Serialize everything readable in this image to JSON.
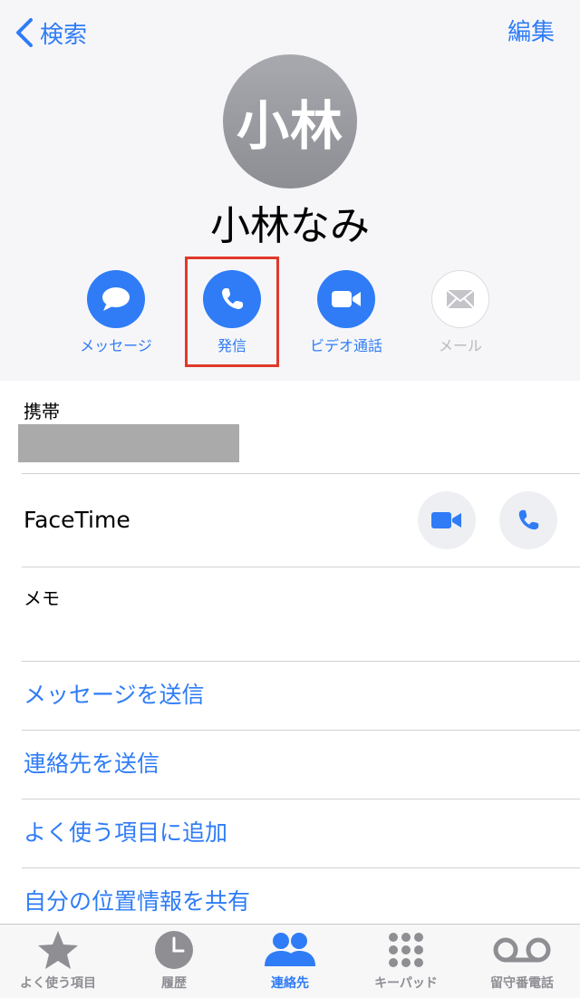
{
  "nav": {
    "back_label": "検索",
    "edit_label": "編集"
  },
  "contact": {
    "avatar_initials": "小林",
    "name": "小林なみ"
  },
  "actions": [
    {
      "label": "メッセージ",
      "icon": "message-bubble-icon",
      "enabled": true
    },
    {
      "label": "発信",
      "icon": "phone-icon",
      "enabled": true,
      "highlighted": true
    },
    {
      "label": "ビデオ通話",
      "icon": "video-camera-icon",
      "enabled": true
    },
    {
      "label": "メール",
      "icon": "mail-envelope-icon",
      "enabled": false
    }
  ],
  "details": {
    "mobile_label": "携帯",
    "facetime_label": "FaceTime",
    "memo_label": "メモ"
  },
  "links": [
    {
      "label": "メッセージを送信"
    },
    {
      "label": "連絡先を送信"
    },
    {
      "label": "よく使う項目に追加"
    },
    {
      "label": "自分の位置情報を共有"
    }
  ],
  "tabs": [
    {
      "label": "よく使う項目",
      "icon": "star-icon",
      "active": false
    },
    {
      "label": "履歴",
      "icon": "clock-icon",
      "active": false
    },
    {
      "label": "連絡先",
      "icon": "people-icon",
      "active": true
    },
    {
      "label": "キーパッド",
      "icon": "keypad-icon",
      "active": false
    },
    {
      "label": "留守番電話",
      "icon": "voicemail-icon",
      "active": false
    }
  ],
  "colors": {
    "accent": "#2f7cf6",
    "highlight": "#e0392a",
    "inactive": "#8e8e93"
  }
}
